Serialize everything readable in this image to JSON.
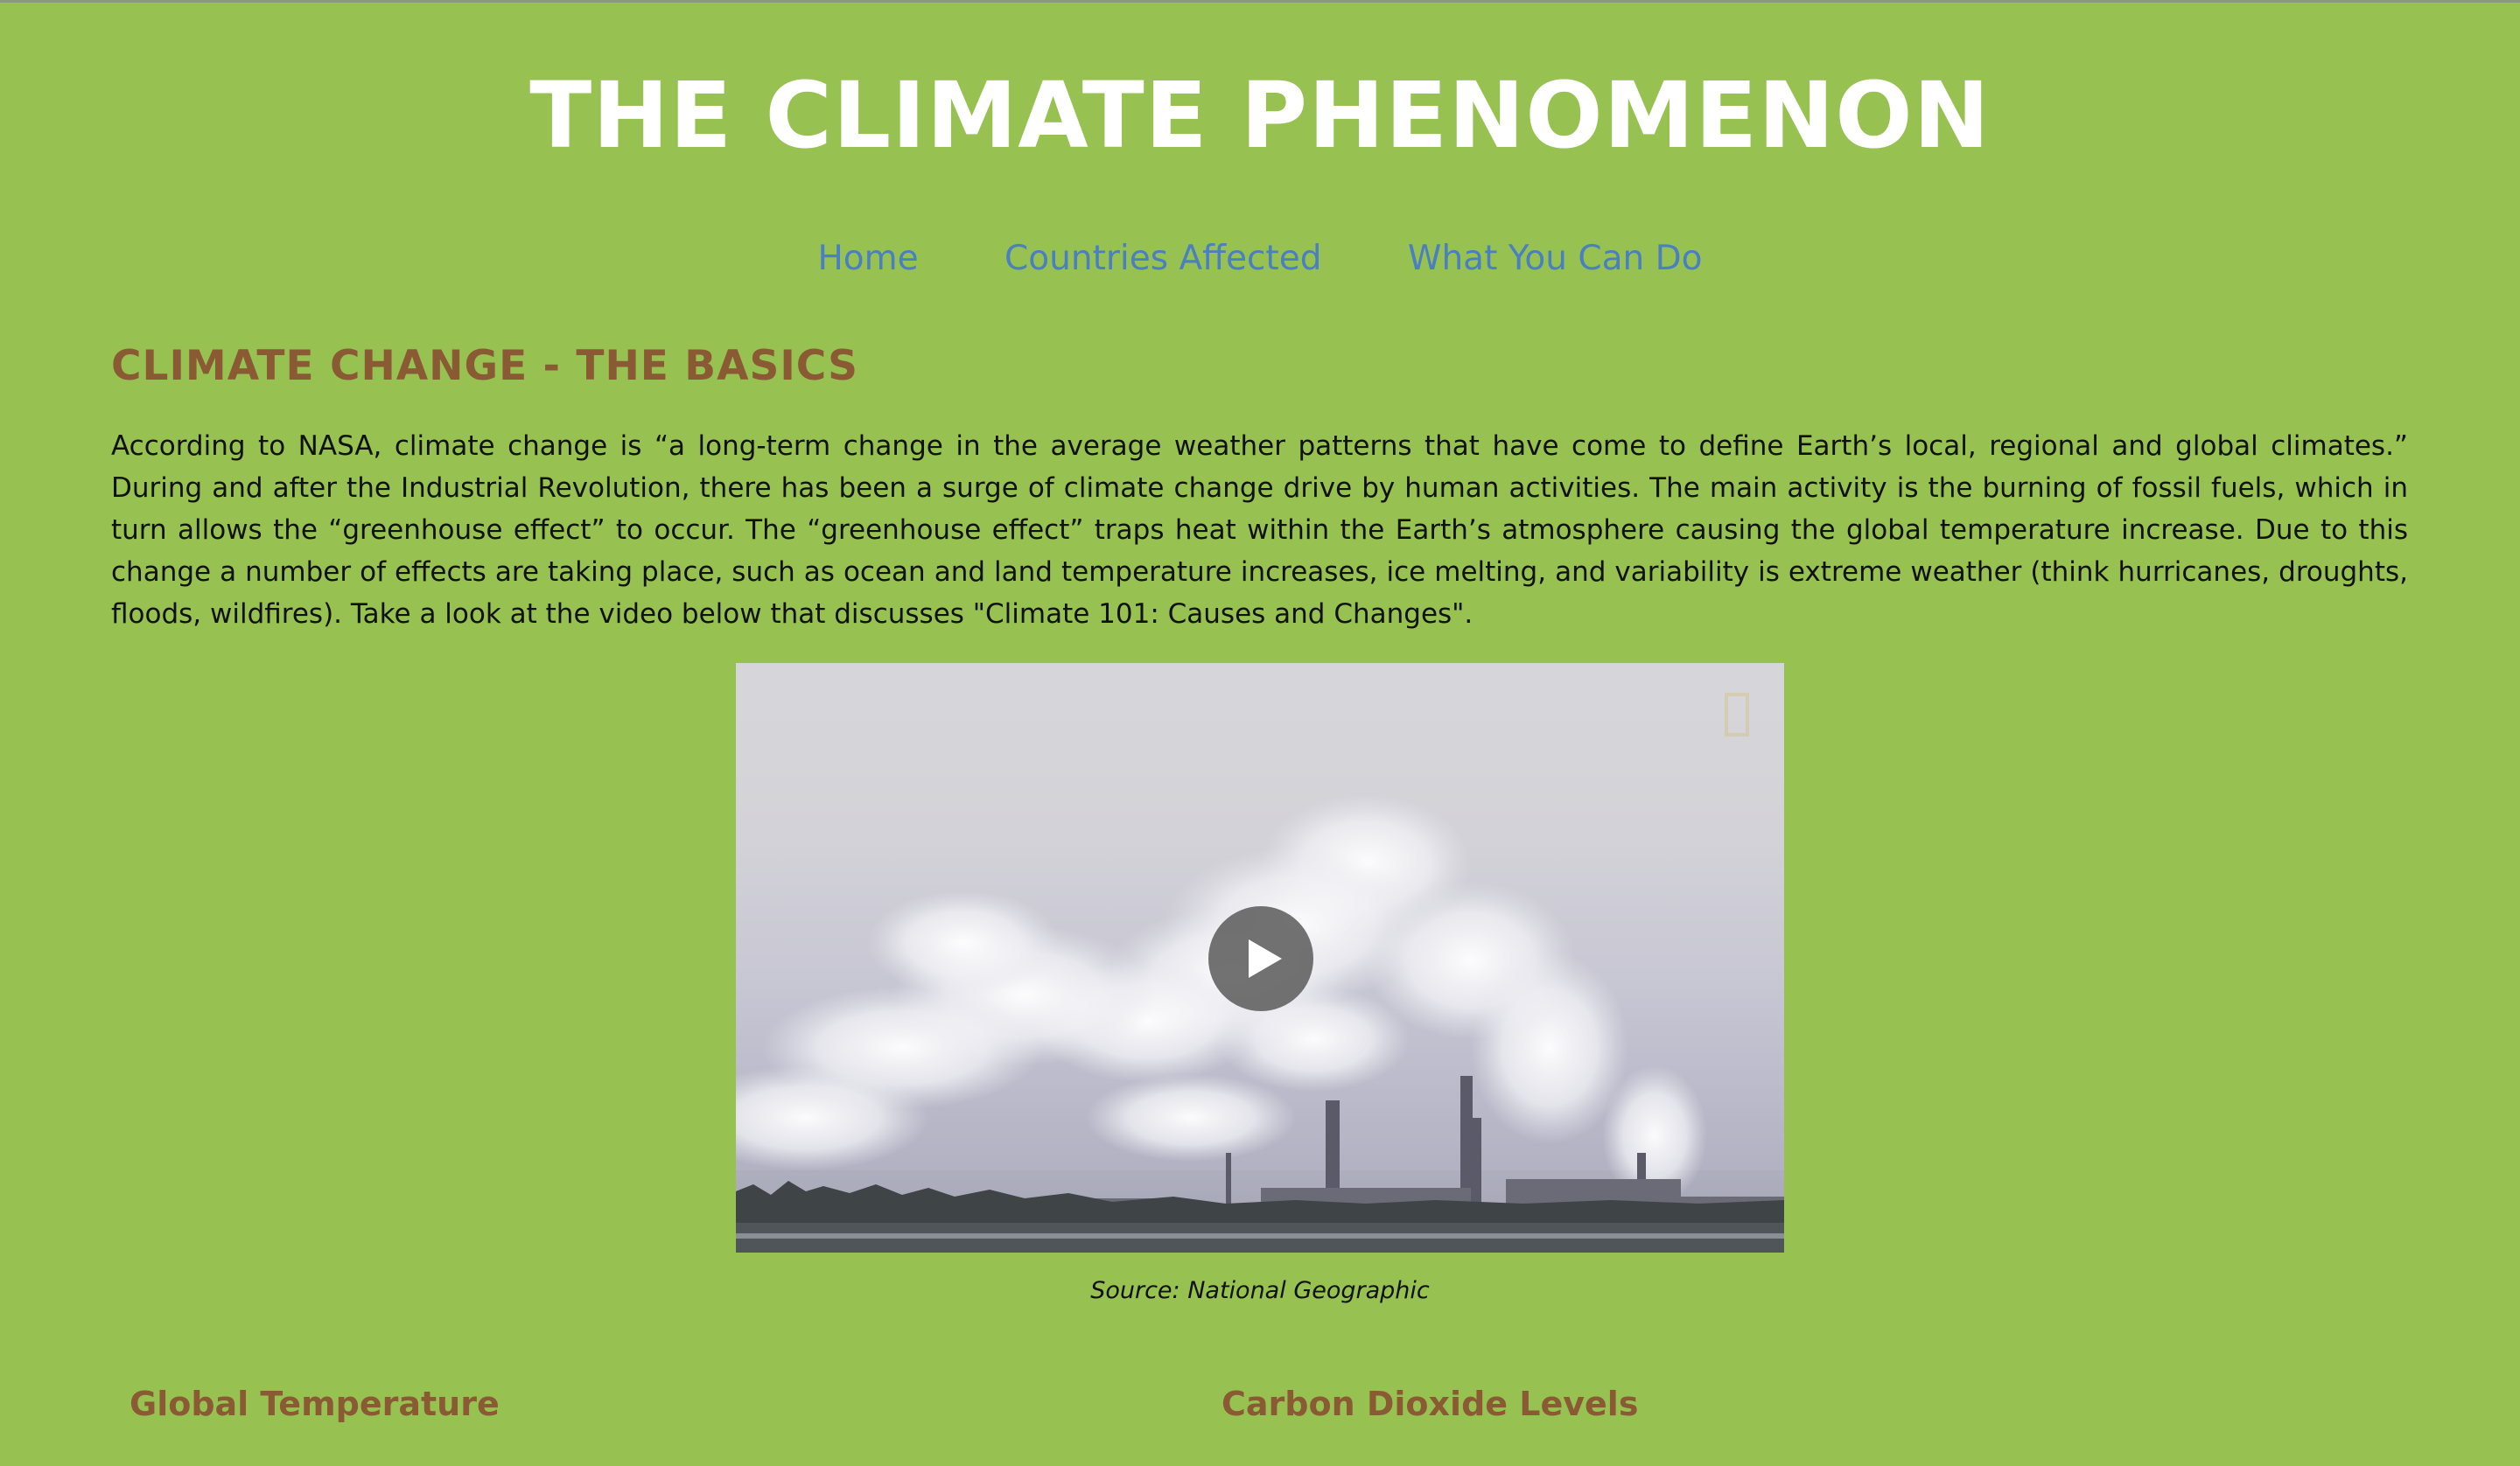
{
  "site": {
    "title": "THE CLIMATE PHENOMENON"
  },
  "nav": {
    "items": [
      {
        "label": "Home"
      },
      {
        "label": "Countries Affected"
      },
      {
        "label": "What You Can Do"
      }
    ]
  },
  "main": {
    "heading": "CLIMATE CHANGE - THE BASICS",
    "intro": "According to NASA, climate change is “a long-term change in the average weather patterns that have come to define Earth’s local, regional and global climates.” During and after the Industrial Revolution, there has been a surge of climate change drive by human activities. The main activity is the burning of fossil fuels, which in turn allows the “greenhouse effect” to occur. The “greenhouse effect” traps heat within the Earth’s atmosphere causing the global temperature increase. Due to this change a number of effects are taking place, such as ocean and land temperature increases, ice melting, and variability is extreme weather (think hurricanes, droughts, floods, wildfires). Take a look at the video below that discusses \"Climate 101: Causes and Changes\".",
    "video": {
      "caption": "Source: National Geographic",
      "play_icon": "play-icon"
    },
    "subsections": [
      {
        "heading": "Global Temperature"
      },
      {
        "heading": "Carbon Dioxide Levels"
      }
    ]
  },
  "colors": {
    "background": "#97c251",
    "title": "#ffffff",
    "nav_link": "#4a7fc1",
    "heading": "#8a5a34",
    "body_text": "#111111"
  }
}
